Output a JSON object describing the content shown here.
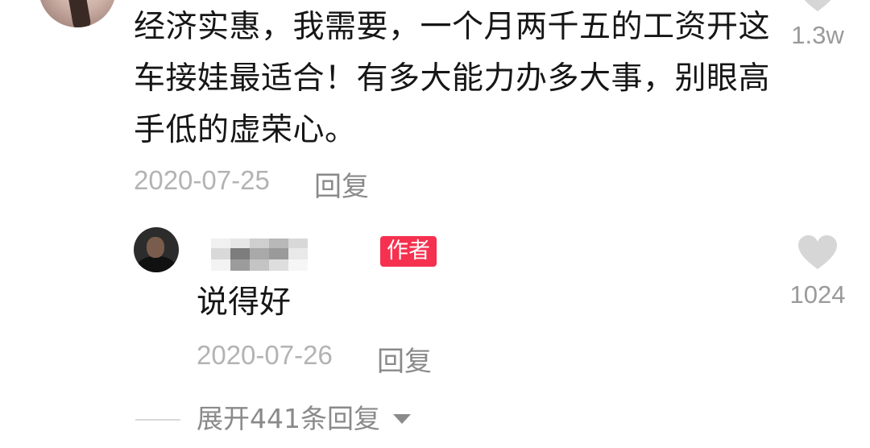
{
  "top_comment": {
    "text": "经济实惠，我需要，一个月两千五的工资开这车接娃最适合！有多大能力办多大事，别眼高手低的虚荣心。",
    "date": "2020-07-25",
    "reply_label": "回复",
    "like_count": "1.3w"
  },
  "reply": {
    "badge": "作者",
    "text": "说得好",
    "date": "2020-07-26",
    "reply_label": "回复",
    "like_count": "1024"
  },
  "expand": {
    "label": "展开441条回复",
    "icon": "caret-down-icon"
  },
  "colors": {
    "badge": "#f5314f",
    "heart": "#d6d6d6",
    "muted_text": "#8a8a8a",
    "date_text": "#b3b3b3"
  }
}
